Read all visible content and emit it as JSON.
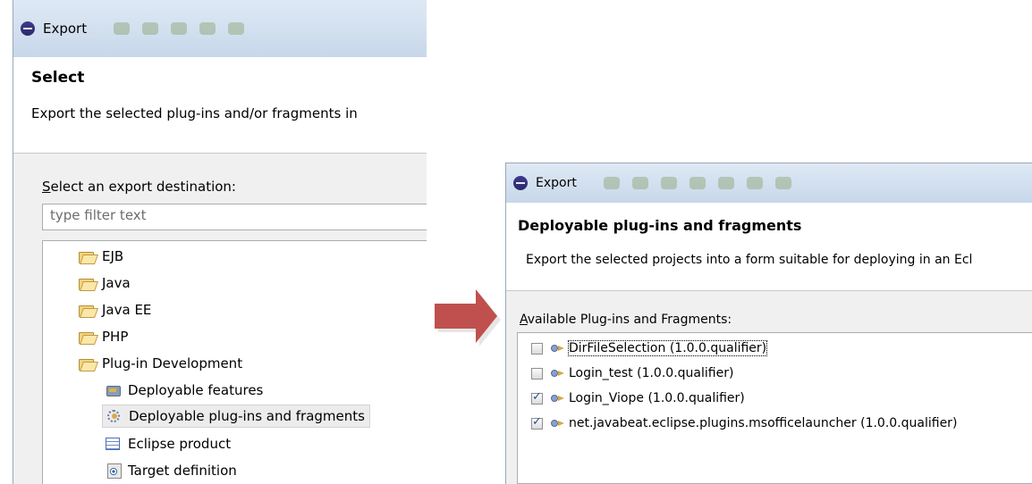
{
  "left_window": {
    "title": "Export",
    "header_title": "Select",
    "header_description": "Export the selected plug-ins and/or fragments in",
    "destination_label_prefix": "S",
    "destination_label_rest": "elect an export destination:",
    "filter_placeholder": "type filter text",
    "tree": [
      {
        "label": "EJB",
        "icon": "folder-icon"
      },
      {
        "label": "Java",
        "icon": "folder-icon"
      },
      {
        "label": "Java EE",
        "icon": "folder-icon"
      },
      {
        "label": "PHP",
        "icon": "folder-icon"
      },
      {
        "label": "Plug-in Development",
        "icon": "folder-open-icon"
      },
      {
        "label": "Deployable features",
        "icon": "feature-icon"
      },
      {
        "label": "Deployable plug-ins and fragments",
        "icon": "plugins-icon",
        "selected": true
      },
      {
        "label": "Eclipse product",
        "icon": "product-icon"
      },
      {
        "label": "Target definition",
        "icon": "target-icon"
      }
    ]
  },
  "right_window": {
    "title": "Export",
    "header_title": "Deployable plug-ins and fragments",
    "header_description": "Export the selected projects into a form suitable for deploying in an Ecl",
    "available_label_prefix": "A",
    "available_label_rest": "vailable Plug-ins and Fragments:",
    "plugins": [
      {
        "label": "DirFileSelection (1.0.0.qualifier)",
        "checked": false
      },
      {
        "label": "Login_test (1.0.0.qualifier)",
        "checked": false
      },
      {
        "label": "Login_Viope (1.0.0.qualifier)",
        "checked": true
      },
      {
        "label": "net.javabeat.eclipse.plugins.msofficelauncher (1.0.0.qualifier)",
        "checked": true
      }
    ]
  },
  "colors": {
    "arrow": "#c0504d",
    "titlebar": "#d3e0f0",
    "dialog_bg": "#f0f0f0"
  }
}
